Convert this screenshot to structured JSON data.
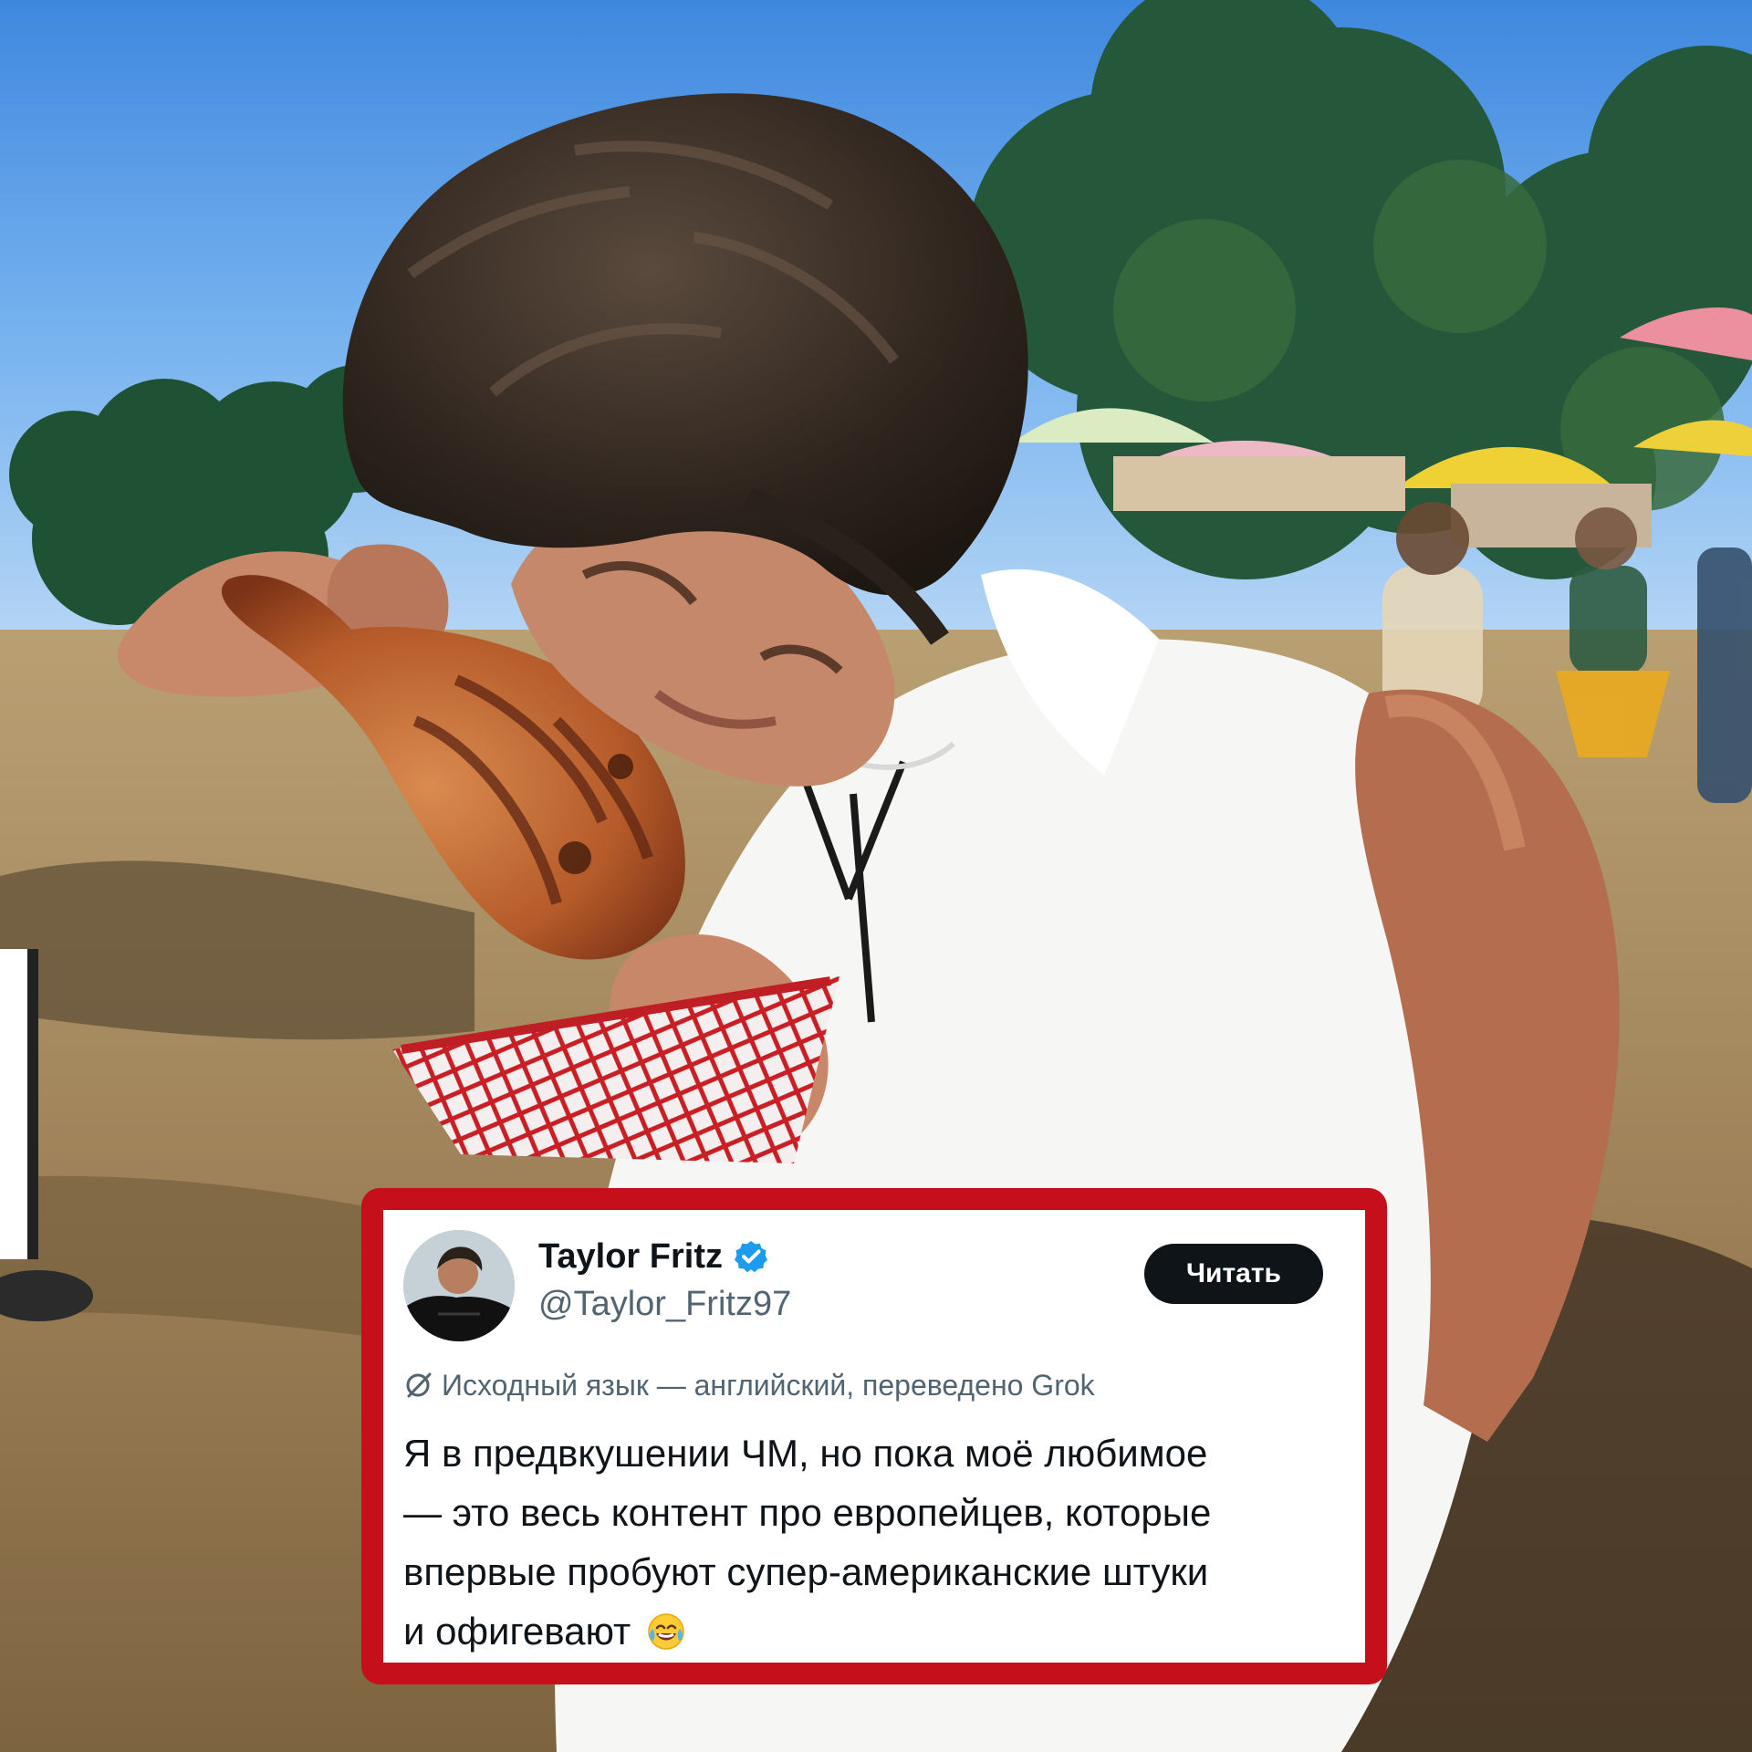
{
  "tweet": {
    "author_name": "Taylor Fritz",
    "author_handle": "@Taylor_Fritz97",
    "follow_label": "Читать",
    "translation_note": "Исходный язык — английский, переведено Grok",
    "lines": [
      "Я в предвкушении ЧМ, но пока моё любимое",
      "— это весь контент про европейцев, которые",
      "впервые пробуют супер-американские штуки",
      "и офигевают"
    ],
    "verified_icon": "verified-badge-icon",
    "translate_icon": "translate-slash-icon",
    "emoji_icon": "laughing-tears-emoji"
  },
  "colors": {
    "card_border": "#c5101c",
    "verified_badge": "#1d9bf0",
    "follow_button_bg": "#0f1419",
    "secondary_text": "#536471"
  }
}
